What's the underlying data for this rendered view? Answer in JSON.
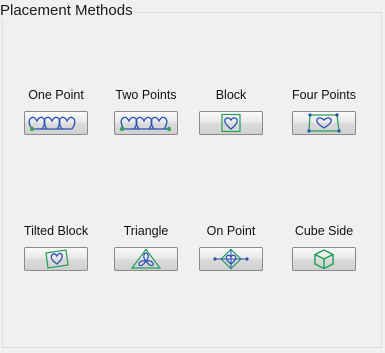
{
  "group": {
    "title": "Placement Methods"
  },
  "methods": [
    {
      "label": "One Point",
      "icon": "one-point-icon"
    },
    {
      "label": "Two Points",
      "icon": "two-points-icon"
    },
    {
      "label": "Block",
      "icon": "block-icon"
    },
    {
      "label": "Four Points",
      "icon": "four-points-icon"
    },
    {
      "label": "Tilted Block",
      "icon": "tilted-block-icon"
    },
    {
      "label": "Triangle",
      "icon": "triangle-icon"
    },
    {
      "label": "On Point",
      "icon": "on-point-icon"
    },
    {
      "label": "Cube Side",
      "icon": "cube-side-icon"
    }
  ],
  "colors": {
    "icon_blue": "#2a4fb5",
    "icon_green": "#21a05a",
    "handle_green": "#3aa35a"
  }
}
